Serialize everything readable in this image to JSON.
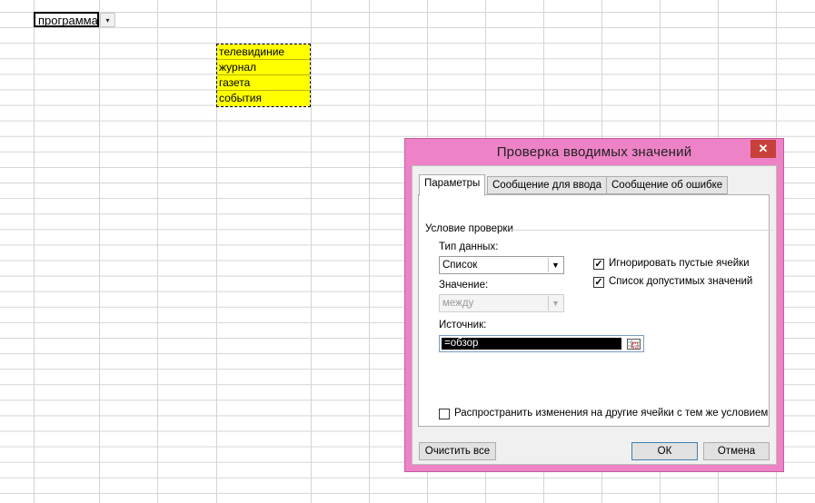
{
  "sheet": {
    "active_cell_value": "программа",
    "dropdown_arrow": "▾",
    "list_items": [
      "телевидиние",
      "журнал",
      "газета",
      "события"
    ]
  },
  "dialog": {
    "title": "Проверка вводимых значений",
    "close_label": "✕",
    "tabs": [
      "Параметры",
      "Сообщение для ввода",
      "Сообщение об ошибке"
    ],
    "group_title": "Условие проверки",
    "data_type_label": "Тип данных:",
    "data_type_value": "Список",
    "value_label": "Значение:",
    "value_value": "между",
    "ignore_blank_label": "Игнорировать пустые ячейки",
    "in_cell_dropdown_label": "Список допустимых значений",
    "ignore_blank_checked": true,
    "in_cell_dropdown_checked": true,
    "source_label": "Источник:",
    "source_value": "=обзор",
    "apply_all_label": "Распространить изменения на другие ячейки с тем же условием",
    "apply_all_checked": false,
    "clear_all_label": "Очистить все",
    "ok_label": "ОК",
    "cancel_label": "Отмена",
    "combo_arrow": "▼",
    "check_mark": "✓"
  },
  "colors": {
    "dialog_frame": "#ee82c6",
    "close_button": "#c7403a",
    "list_fill": "#ffff00"
  }
}
